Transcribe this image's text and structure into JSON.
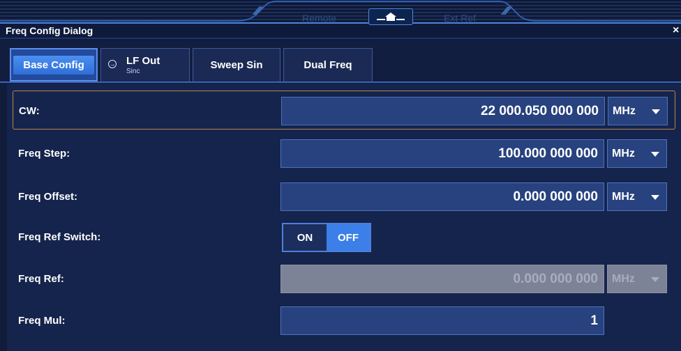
{
  "header": {
    "dialog_title": "Freq Config Dialog",
    "remote_label": "Remote",
    "ext_ref_label": "Ext Ref",
    "deco_left": "⁄⁄⁄⁄",
    "deco_right": "⁄⁄⁄⁄",
    "close_glyph": "×"
  },
  "tabs": [
    {
      "label": "Base Config",
      "active": true
    },
    {
      "label": "LF Out",
      "sub": "Sinc",
      "active": false
    },
    {
      "label": "Sweep Sin",
      "active": false
    },
    {
      "label": "Dual Freq",
      "active": false
    }
  ],
  "rows": {
    "cw": {
      "label": "CW:",
      "value": "22 000.050 000 000",
      "unit": "MHz"
    },
    "freq_step": {
      "label": "Freq Step:",
      "value": "100.000 000 000",
      "unit": "MHz"
    },
    "freq_offset": {
      "label": "Freq Offset:",
      "value": "0.000 000 000",
      "unit": "MHz"
    },
    "freq_ref_switch": {
      "label": "Freq Ref Switch:",
      "on_label": "ON",
      "off_label": "OFF",
      "selected": "OFF"
    },
    "freq_ref": {
      "label": "Freq Ref:",
      "value": "0.000 000 000",
      "unit": "MHz",
      "disabled": true
    },
    "freq_mul": {
      "label": "Freq Mul:",
      "value": "1"
    }
  },
  "colors": {
    "background": "#101c3a",
    "accent": "#3c7fe8",
    "selected_border": "#b9864a",
    "disabled_field": "#7d8396"
  }
}
